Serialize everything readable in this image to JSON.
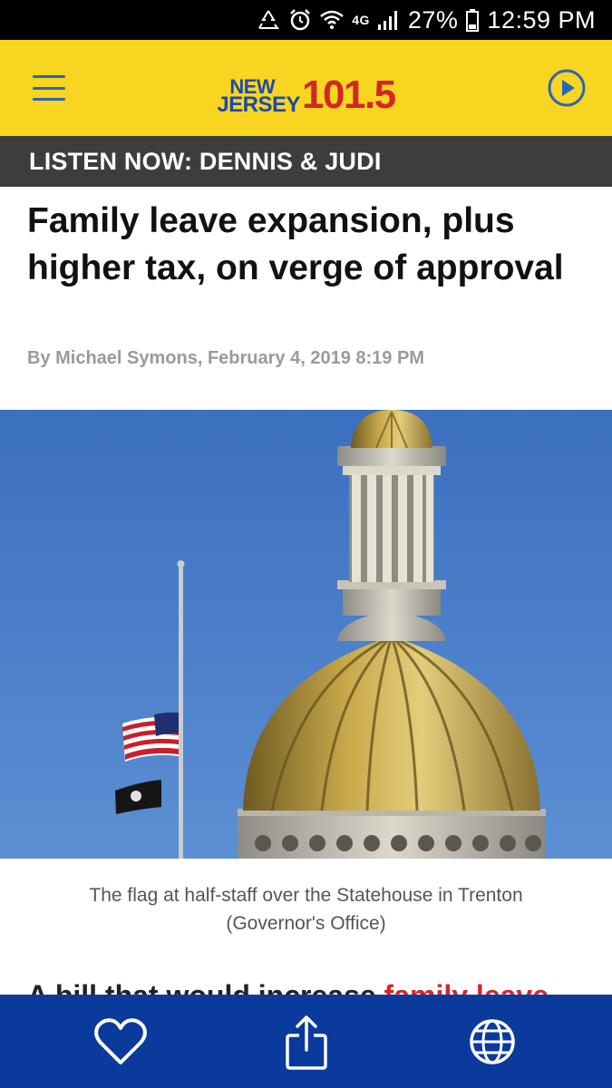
{
  "status_bar": {
    "network": "4G",
    "battery": "27%",
    "time": "12:59 PM"
  },
  "header": {
    "logo_new": "NEW",
    "logo_jersey": "JERSEY",
    "logo_number": "101.5"
  },
  "listen_bar": {
    "text": "LISTEN NOW: DENNIS & JUDI"
  },
  "article": {
    "headline": "Family leave expansion, plus higher tax, on verge of approval",
    "byline": "By Michael Symons, February 4, 2019 8:19 PM",
    "caption_line1": "The flag at half-staff over the Statehouse in Trenton",
    "caption_line2": "(Governor's Office)",
    "body_start": "A bill that would increase",
    "body_link": "family leave"
  },
  "bottom_bar": {
    "icons": [
      "heart-icon",
      "share-icon",
      "globe-icon"
    ]
  },
  "colors": {
    "header_bg": "#f7d521",
    "brand_blue": "#1f4aa8",
    "brand_red": "#d4262a",
    "listen_bar_bg": "#3d3d3d",
    "bottom_bar_bg": "#0b3a9d"
  }
}
